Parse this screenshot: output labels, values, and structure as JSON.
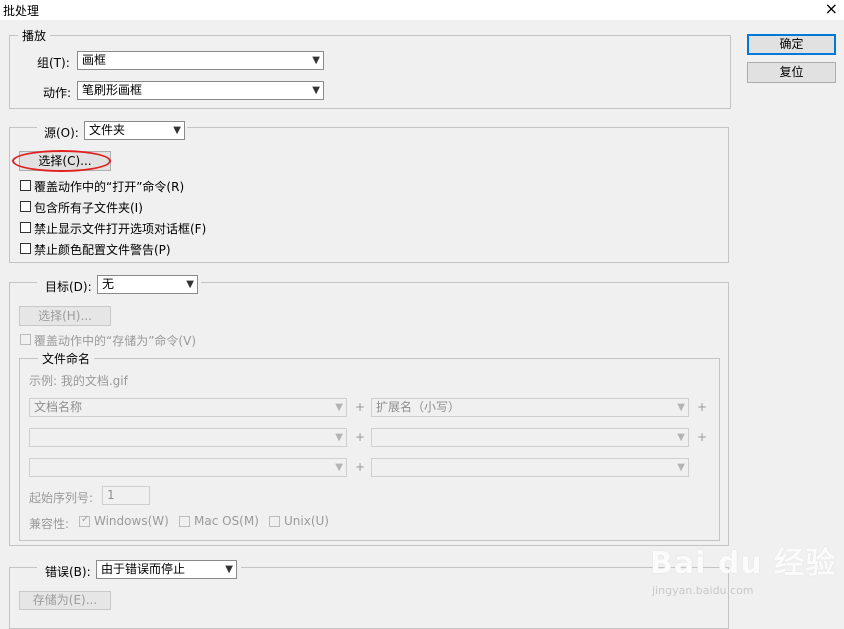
{
  "window": {
    "title": "批处理",
    "close_icon": "×"
  },
  "play": {
    "legend": "播放",
    "group_label": "组(T):",
    "group_value": "画框",
    "action_label": "动作:",
    "action_value": "笔刷形画框"
  },
  "buttons": {
    "ok": "确定",
    "reset": "复位"
  },
  "source": {
    "label": "源(O):",
    "value": "文件夹",
    "choose": "选择(C)...",
    "options": [
      "覆盖动作中的“打开”命令(R)",
      "包含所有子文件夹(I)",
      "禁止显示文件打开选项对话框(F)",
      "禁止颜色配置文件警告(P)"
    ]
  },
  "target": {
    "label": "目标(D):",
    "value": "无",
    "choose": "选择(H)...",
    "override": "覆盖动作中的“存储为”命令(V)",
    "naming": {
      "legend": "文件命名",
      "example": "示例: 我的文档.gif",
      "rows": [
        {
          "left": "文档名称",
          "right": "扩展名（小写）",
          "right_plus": true
        },
        {
          "left": "",
          "right": "",
          "right_plus": true
        },
        {
          "left": "",
          "right": "",
          "right_plus": false
        }
      ],
      "plus": "+",
      "start_serial_label": "起始序列号:",
      "start_serial_value": "1",
      "compat_label": "兼容性:",
      "compat": [
        {
          "label": "Windows(W)",
          "checked": true
        },
        {
          "label": "Mac OS(M)",
          "checked": false
        },
        {
          "label": "Unix(U)",
          "checked": false
        }
      ]
    }
  },
  "errors": {
    "label": "错误(B):",
    "value": "由于错误而停止",
    "save_as": "存储为(E)..."
  },
  "watermark": {
    "brand": "Bai du 经验",
    "url": "jingyan.baidu.com"
  },
  "colors": {
    "highlight_circle": "#e02020",
    "default_button_border": "#0078d7"
  }
}
